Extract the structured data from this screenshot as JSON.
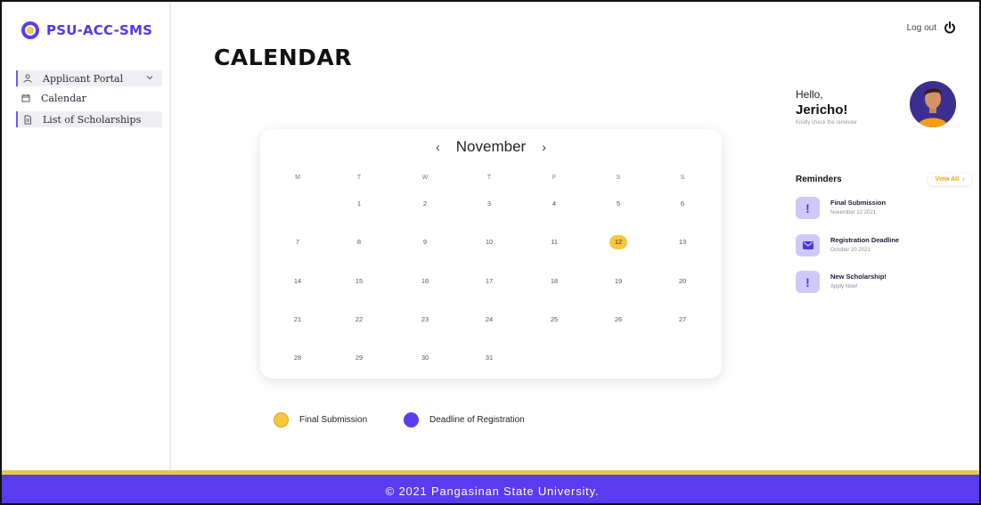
{
  "brand": {
    "name": "PSU-ACC-SMS"
  },
  "nav": {
    "items": [
      {
        "label": "Applicant Portal",
        "icon": "user-icon"
      },
      {
        "label": "Calendar",
        "icon": "calendar-icon"
      },
      {
        "label": "List of Scholarships",
        "icon": "document-icon"
      }
    ]
  },
  "header": {
    "title": "CALENDAR",
    "logout_label": "Log out"
  },
  "calendar": {
    "month": "November",
    "prev_label": "‹",
    "next_label": "›",
    "weekdays": [
      "M",
      "T",
      "W",
      "T",
      "F",
      "S",
      "S"
    ],
    "weeks": [
      [
        "",
        "1",
        "2",
        "3",
        "4",
        "5",
        "6"
      ],
      [
        "7",
        "8",
        "9",
        "10",
        "11",
        "12",
        "13"
      ],
      [
        "14",
        "15",
        "16",
        "17",
        "18",
        "19",
        "20"
      ],
      [
        "21",
        "22",
        "23",
        "24",
        "25",
        "26",
        "27"
      ],
      [
        "28",
        "29",
        "30",
        "31",
        "",
        "",
        ""
      ]
    ],
    "highlighted_day": "12",
    "highlight_color": "#f7c83b"
  },
  "legend": [
    {
      "label": "Final Submission",
      "color": "#f7c83b"
    },
    {
      "label": "Deadline of Registration",
      "color": "#5b3df0"
    }
  ],
  "greeting": {
    "hello": "Hello,",
    "name": "Jericho!",
    "subtitle": "Kindly check the reminder"
  },
  "reminders": {
    "title": "Reminders",
    "view_all_label": "View All",
    "items": [
      {
        "title": "Final Submission",
        "subtitle": "November 12 2021",
        "icon": "exclamation-icon"
      },
      {
        "title": "Registration Deadline",
        "subtitle": "October 20 2021",
        "icon": "mail-icon"
      },
      {
        "title": "New Scholarship!",
        "subtitle": "Apply Now!",
        "icon": "exclamation-icon"
      }
    ]
  },
  "footer": {
    "text": "© 2021 Pangasinan State University."
  },
  "colors": {
    "accent": "#5a3bf0",
    "highlight": "#f7c83b",
    "footer_stripe": "#e5c84a"
  }
}
